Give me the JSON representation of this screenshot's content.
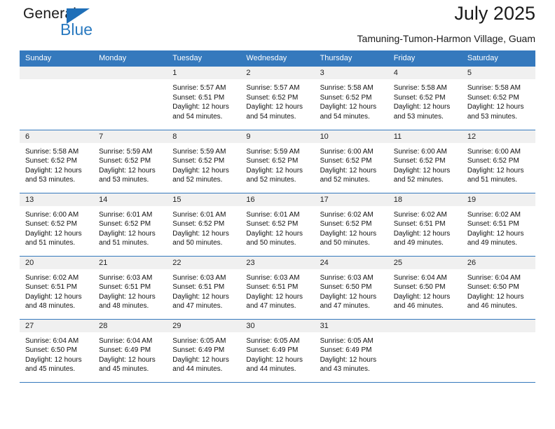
{
  "brand": {
    "name_top": "General",
    "name_bottom": "Blue",
    "triangle_icon": "triangle-icon",
    "color_dark": "#1a1a1a",
    "color_blue": "#2a7ac0"
  },
  "header": {
    "title": "July 2025",
    "subtitle": "Tamuning-Tumon-Harmon Village, Guam"
  },
  "theme": {
    "header_bg": "#3579bd",
    "header_text": "#ffffff",
    "daynum_bg": "#f0f0f0",
    "row_divider": "#3579bd"
  },
  "weekday_headers": [
    "Sunday",
    "Monday",
    "Tuesday",
    "Wednesday",
    "Thursday",
    "Friday",
    "Saturday"
  ],
  "weeks": [
    [
      {
        "day": "",
        "sunrise": "",
        "sunset": "",
        "daylight_a": "",
        "daylight_b": ""
      },
      {
        "day": "",
        "sunrise": "",
        "sunset": "",
        "daylight_a": "",
        "daylight_b": ""
      },
      {
        "day": "1",
        "sunrise": "Sunrise: 5:57 AM",
        "sunset": "Sunset: 6:51 PM",
        "daylight_a": "Daylight: 12 hours",
        "daylight_b": "and 54 minutes."
      },
      {
        "day": "2",
        "sunrise": "Sunrise: 5:57 AM",
        "sunset": "Sunset: 6:52 PM",
        "daylight_a": "Daylight: 12 hours",
        "daylight_b": "and 54 minutes."
      },
      {
        "day": "3",
        "sunrise": "Sunrise: 5:58 AM",
        "sunset": "Sunset: 6:52 PM",
        "daylight_a": "Daylight: 12 hours",
        "daylight_b": "and 54 minutes."
      },
      {
        "day": "4",
        "sunrise": "Sunrise: 5:58 AM",
        "sunset": "Sunset: 6:52 PM",
        "daylight_a": "Daylight: 12 hours",
        "daylight_b": "and 53 minutes."
      },
      {
        "day": "5",
        "sunrise": "Sunrise: 5:58 AM",
        "sunset": "Sunset: 6:52 PM",
        "daylight_a": "Daylight: 12 hours",
        "daylight_b": "and 53 minutes."
      }
    ],
    [
      {
        "day": "6",
        "sunrise": "Sunrise: 5:58 AM",
        "sunset": "Sunset: 6:52 PM",
        "daylight_a": "Daylight: 12 hours",
        "daylight_b": "and 53 minutes."
      },
      {
        "day": "7",
        "sunrise": "Sunrise: 5:59 AM",
        "sunset": "Sunset: 6:52 PM",
        "daylight_a": "Daylight: 12 hours",
        "daylight_b": "and 53 minutes."
      },
      {
        "day": "8",
        "sunrise": "Sunrise: 5:59 AM",
        "sunset": "Sunset: 6:52 PM",
        "daylight_a": "Daylight: 12 hours",
        "daylight_b": "and 52 minutes."
      },
      {
        "day": "9",
        "sunrise": "Sunrise: 5:59 AM",
        "sunset": "Sunset: 6:52 PM",
        "daylight_a": "Daylight: 12 hours",
        "daylight_b": "and 52 minutes."
      },
      {
        "day": "10",
        "sunrise": "Sunrise: 6:00 AM",
        "sunset": "Sunset: 6:52 PM",
        "daylight_a": "Daylight: 12 hours",
        "daylight_b": "and 52 minutes."
      },
      {
        "day": "11",
        "sunrise": "Sunrise: 6:00 AM",
        "sunset": "Sunset: 6:52 PM",
        "daylight_a": "Daylight: 12 hours",
        "daylight_b": "and 52 minutes."
      },
      {
        "day": "12",
        "sunrise": "Sunrise: 6:00 AM",
        "sunset": "Sunset: 6:52 PM",
        "daylight_a": "Daylight: 12 hours",
        "daylight_b": "and 51 minutes."
      }
    ],
    [
      {
        "day": "13",
        "sunrise": "Sunrise: 6:00 AM",
        "sunset": "Sunset: 6:52 PM",
        "daylight_a": "Daylight: 12 hours",
        "daylight_b": "and 51 minutes."
      },
      {
        "day": "14",
        "sunrise": "Sunrise: 6:01 AM",
        "sunset": "Sunset: 6:52 PM",
        "daylight_a": "Daylight: 12 hours",
        "daylight_b": "and 51 minutes."
      },
      {
        "day": "15",
        "sunrise": "Sunrise: 6:01 AM",
        "sunset": "Sunset: 6:52 PM",
        "daylight_a": "Daylight: 12 hours",
        "daylight_b": "and 50 minutes."
      },
      {
        "day": "16",
        "sunrise": "Sunrise: 6:01 AM",
        "sunset": "Sunset: 6:52 PM",
        "daylight_a": "Daylight: 12 hours",
        "daylight_b": "and 50 minutes."
      },
      {
        "day": "17",
        "sunrise": "Sunrise: 6:02 AM",
        "sunset": "Sunset: 6:52 PM",
        "daylight_a": "Daylight: 12 hours",
        "daylight_b": "and 50 minutes."
      },
      {
        "day": "18",
        "sunrise": "Sunrise: 6:02 AM",
        "sunset": "Sunset: 6:51 PM",
        "daylight_a": "Daylight: 12 hours",
        "daylight_b": "and 49 minutes."
      },
      {
        "day": "19",
        "sunrise": "Sunrise: 6:02 AM",
        "sunset": "Sunset: 6:51 PM",
        "daylight_a": "Daylight: 12 hours",
        "daylight_b": "and 49 minutes."
      }
    ],
    [
      {
        "day": "20",
        "sunrise": "Sunrise: 6:02 AM",
        "sunset": "Sunset: 6:51 PM",
        "daylight_a": "Daylight: 12 hours",
        "daylight_b": "and 48 minutes."
      },
      {
        "day": "21",
        "sunrise": "Sunrise: 6:03 AM",
        "sunset": "Sunset: 6:51 PM",
        "daylight_a": "Daylight: 12 hours",
        "daylight_b": "and 48 minutes."
      },
      {
        "day": "22",
        "sunrise": "Sunrise: 6:03 AM",
        "sunset": "Sunset: 6:51 PM",
        "daylight_a": "Daylight: 12 hours",
        "daylight_b": "and 47 minutes."
      },
      {
        "day": "23",
        "sunrise": "Sunrise: 6:03 AM",
        "sunset": "Sunset: 6:51 PM",
        "daylight_a": "Daylight: 12 hours",
        "daylight_b": "and 47 minutes."
      },
      {
        "day": "24",
        "sunrise": "Sunrise: 6:03 AM",
        "sunset": "Sunset: 6:50 PM",
        "daylight_a": "Daylight: 12 hours",
        "daylight_b": "and 47 minutes."
      },
      {
        "day": "25",
        "sunrise": "Sunrise: 6:04 AM",
        "sunset": "Sunset: 6:50 PM",
        "daylight_a": "Daylight: 12 hours",
        "daylight_b": "and 46 minutes."
      },
      {
        "day": "26",
        "sunrise": "Sunrise: 6:04 AM",
        "sunset": "Sunset: 6:50 PM",
        "daylight_a": "Daylight: 12 hours",
        "daylight_b": "and 46 minutes."
      }
    ],
    [
      {
        "day": "27",
        "sunrise": "Sunrise: 6:04 AM",
        "sunset": "Sunset: 6:50 PM",
        "daylight_a": "Daylight: 12 hours",
        "daylight_b": "and 45 minutes."
      },
      {
        "day": "28",
        "sunrise": "Sunrise: 6:04 AM",
        "sunset": "Sunset: 6:49 PM",
        "daylight_a": "Daylight: 12 hours",
        "daylight_b": "and 45 minutes."
      },
      {
        "day": "29",
        "sunrise": "Sunrise: 6:05 AM",
        "sunset": "Sunset: 6:49 PM",
        "daylight_a": "Daylight: 12 hours",
        "daylight_b": "and 44 minutes."
      },
      {
        "day": "30",
        "sunrise": "Sunrise: 6:05 AM",
        "sunset": "Sunset: 6:49 PM",
        "daylight_a": "Daylight: 12 hours",
        "daylight_b": "and 44 minutes."
      },
      {
        "day": "31",
        "sunrise": "Sunrise: 6:05 AM",
        "sunset": "Sunset: 6:49 PM",
        "daylight_a": "Daylight: 12 hours",
        "daylight_b": "and 43 minutes."
      },
      {
        "day": "",
        "sunrise": "",
        "sunset": "",
        "daylight_a": "",
        "daylight_b": ""
      },
      {
        "day": "",
        "sunrise": "",
        "sunset": "",
        "daylight_a": "",
        "daylight_b": ""
      }
    ]
  ]
}
